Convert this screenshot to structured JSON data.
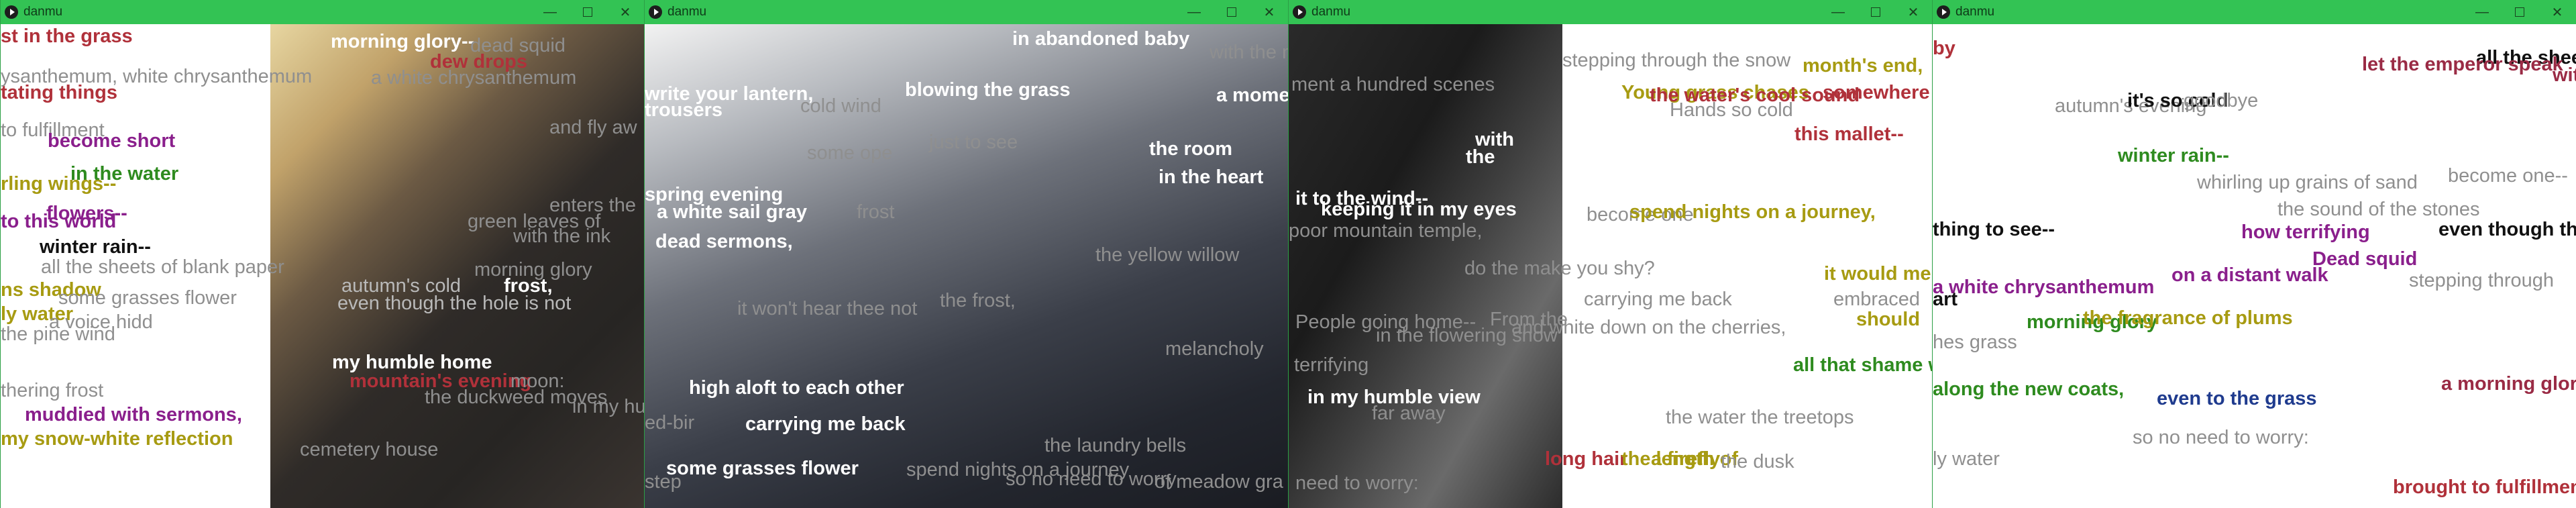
{
  "windows": [
    {
      "title": "danmu",
      "icons": {
        "app": "play-icon",
        "minimize": "minimize-icon",
        "maximize": "maximize-icon",
        "close": "close-icon"
      },
      "comments": [
        "st in the grass",
        "ysanthemum, white chrysanthemum",
        "tating things",
        "to fulfillment",
        "become short",
        "in the water",
        "rling wings--",
        "flowers--",
        "winter rain--",
        "to this world",
        "all the sheets of blank paper",
        "ns shadow",
        "some grasses flower",
        "ly water",
        "a voice hidd",
        "the pine wind",
        "thering frost",
        "muddied with sermons,",
        "my snow-white reflection",
        "morning glory--",
        "dead squid",
        "dew drops",
        "a white chrysanthemum",
        "and fly aw",
        "enters the",
        "green leaves of",
        "with the ink",
        "morning glory",
        "autumn's cold",
        "frost,",
        "even though the hole is not",
        "my humble home",
        "mountain's evening",
        "moon:",
        "the duckweed moves",
        "in my hu",
        "cemetery house"
      ]
    },
    {
      "title": "danmu",
      "icons": {
        "app": "play-icon",
        "minimize": "minimize-icon",
        "maximize": "maximize-icon",
        "close": "close-icon"
      },
      "comments": [
        "in abandoned baby",
        "with the moon",
        "write your lantern,",
        "blowing the grass",
        "a moment",
        "trousers",
        "cold wind",
        "some ope",
        "just to see",
        "the room",
        "in the heart",
        "spring evening",
        "a white sail gray",
        "frost",
        "dead sermons,",
        "the yellow willow",
        "it won't hear thee not",
        "the frost,",
        "melancholy",
        "high aloft to each other",
        "carrying me back",
        "some grasses flower",
        "the laundry bells",
        "spend nights on a journey",
        "so no need to worry",
        "of meadow gra",
        "ed-bir",
        "step"
      ]
    },
    {
      "title": "danmu",
      "icons": {
        "app": "play-icon",
        "minimize": "minimize-icon",
        "maximize": "maximize-icon",
        "close": "close-icon"
      },
      "comments": [
        "stepping through the snow",
        "month's end,",
        "ment a hundred scenes",
        "Young grass chases",
        "the water's cool sound",
        "somewhere",
        "Hands so cold",
        "this mallet--",
        "with",
        "the",
        "it to the wind--",
        "keeping it in my eyes",
        "become one",
        "spend nights on a journey,",
        "poor mountain temple,",
        "do the make you shy?",
        "it would me",
        "carrying me back",
        "embraced",
        "should",
        "People going home--",
        "From the",
        "firefly",
        "and white down on the cherries,",
        "in the flowering snow",
        "terrifying",
        "all that shame w",
        "in my humble view",
        "far away",
        "the water the treetops",
        "long hair",
        "the length of",
        "a firefly",
        "the dusk",
        "need to worry:"
      ]
    },
    {
      "title": "danmu",
      "icons": {
        "app": "play-icon",
        "minimize": "minimize-icon",
        "maximize": "maximize-icon",
        "close": "close-icon"
      },
      "comments": [
        "by",
        "all the sheets",
        "let the emperor speak",
        "with t",
        "autumn's evening",
        "it's so cold",
        "goodbye",
        "winter rain--",
        "whirling up grains of sand",
        "become one--",
        "the sound of the stones",
        "thing to see--",
        "how terrifying",
        "even though th",
        "Dead squid",
        "on a distant walk",
        "a white chrysanthemum",
        "stepping through",
        "art",
        "morning glory",
        "the fragrance of plums",
        "hes grass",
        "along the new coats,",
        "even to the grass",
        "a morning glor",
        "so no need to worry:",
        "ly water",
        "brought to fulfillmen"
      ]
    }
  ]
}
